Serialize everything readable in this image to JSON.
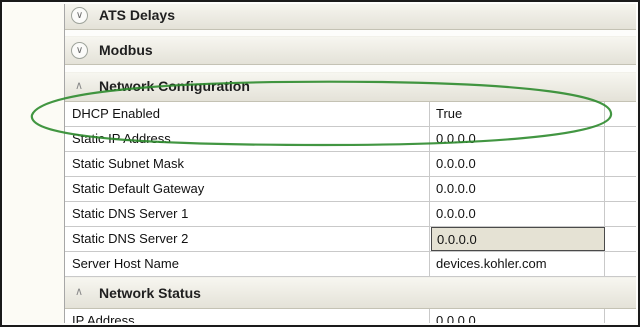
{
  "sections": [
    {
      "label": "ATS Delays",
      "icon": "chevron-down-icon"
    },
    {
      "label": "Modbus",
      "icon": "chevron-down-icon"
    },
    {
      "label": "Network Configuration",
      "icon": "chevron-up-icon"
    },
    {
      "label": "Network Status",
      "icon": "chevron-up-icon"
    }
  ],
  "network_configuration": {
    "rows": [
      {
        "name": "DHCP Enabled",
        "value": "True"
      },
      {
        "name": "Static IP Address",
        "value": "0.0.0.0"
      },
      {
        "name": "Static Subnet Mask",
        "value": "0.0.0.0"
      },
      {
        "name": "Static Default Gateway",
        "value": "0.0.0.0"
      },
      {
        "name": "Static DNS Server 1",
        "value": "0.0.0.0"
      },
      {
        "name": "Static DNS Server 2",
        "value": "0.0.0.0"
      },
      {
        "name": "Server Host Name",
        "value": "devices.kohler.com"
      }
    ]
  },
  "network_status": {
    "rows": [
      {
        "name": "IP Address",
        "value": "0.0.0.0"
      }
    ]
  },
  "annotation": {
    "color": "#2e8b2e",
    "shape": "ellipse"
  }
}
